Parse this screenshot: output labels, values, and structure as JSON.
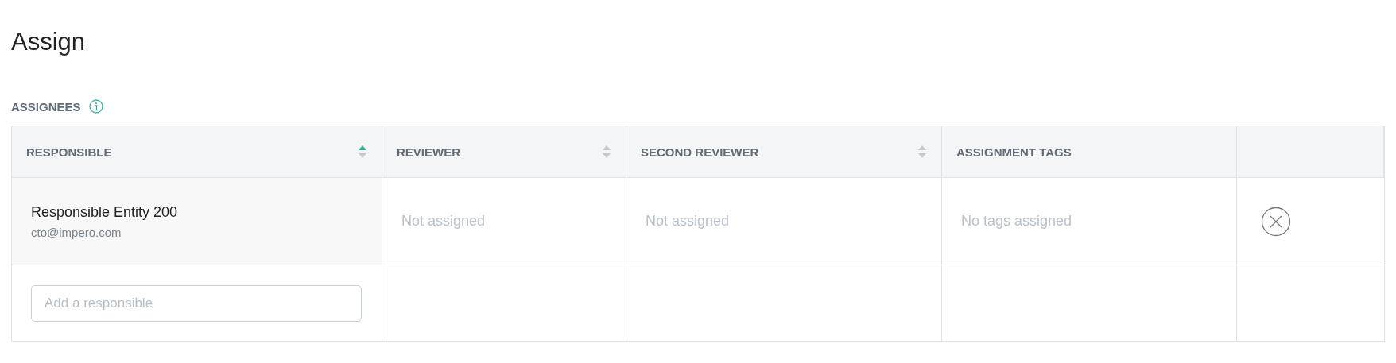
{
  "page_title": "Assign",
  "section": {
    "label": "ASSIGNEES"
  },
  "table": {
    "columns": [
      {
        "label": "RESPONSIBLE",
        "sortable": true,
        "sorted": true
      },
      {
        "label": "REVIEWER",
        "sortable": true,
        "sorted": false
      },
      {
        "label": "SECOND REVIEWER",
        "sortable": true,
        "sorted": false
      },
      {
        "label": "ASSIGNMENT TAGS"
      },
      {}
    ],
    "rows": [
      {
        "responsible": {
          "name": "Responsible Entity 200",
          "email": "cto@impero.com"
        },
        "reviewer": "Not assigned",
        "second_reviewer": "Not assigned",
        "tags": "No tags assigned"
      }
    ],
    "add_field": {
      "placeholder": "Add a responsible"
    }
  }
}
